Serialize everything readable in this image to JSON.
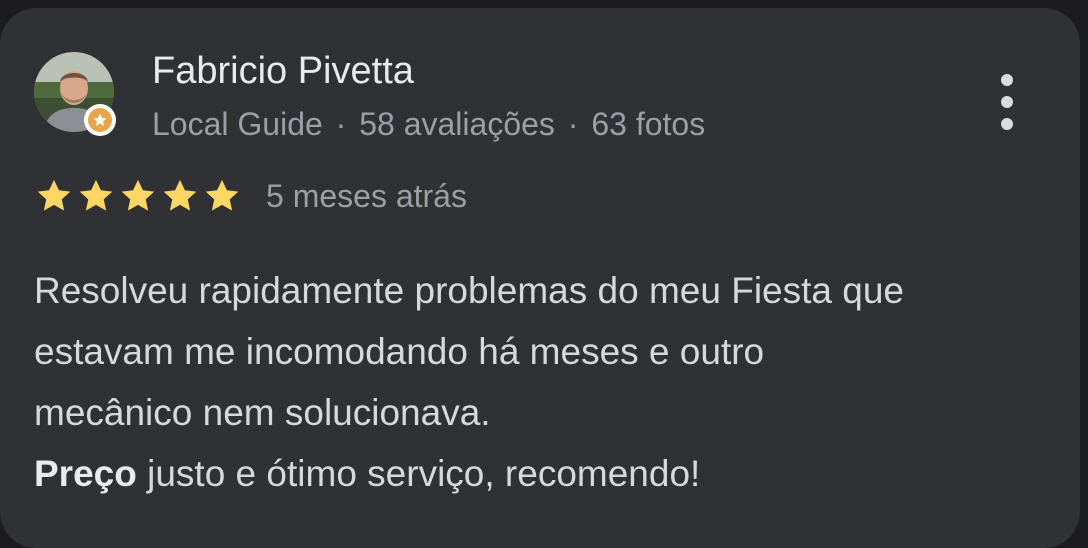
{
  "reviewer": {
    "name": "Fabricio Pivetta",
    "badge": "Local Guide",
    "reviews_count": "58 avaliações",
    "photos_count": "63 fotos",
    "separator": "·",
    "avatar_icon": "user-avatar-photo",
    "guide_badge_icon": "local-guide-star-icon"
  },
  "menu": {
    "icon": "more-vert-icon"
  },
  "rating": {
    "stars": 5,
    "max_stars": 5,
    "star_color": "#fdd663",
    "date": "5 meses atrás"
  },
  "review": {
    "lines": [
      "Resolveu rapidamente problemas do meu Fiesta que",
      "estavam me incomodando há meses e outro",
      "mecânico nem solucionava."
    ],
    "last_line_bold": "Preço",
    "last_line_rest": " justo e ótimo serviço, recomendo!"
  },
  "colors": {
    "background": "#1c1c1e",
    "card": "#303134",
    "primary_text": "#e8eaed",
    "secondary_text": "#9aa0a6",
    "badge": "#e8a64a"
  }
}
